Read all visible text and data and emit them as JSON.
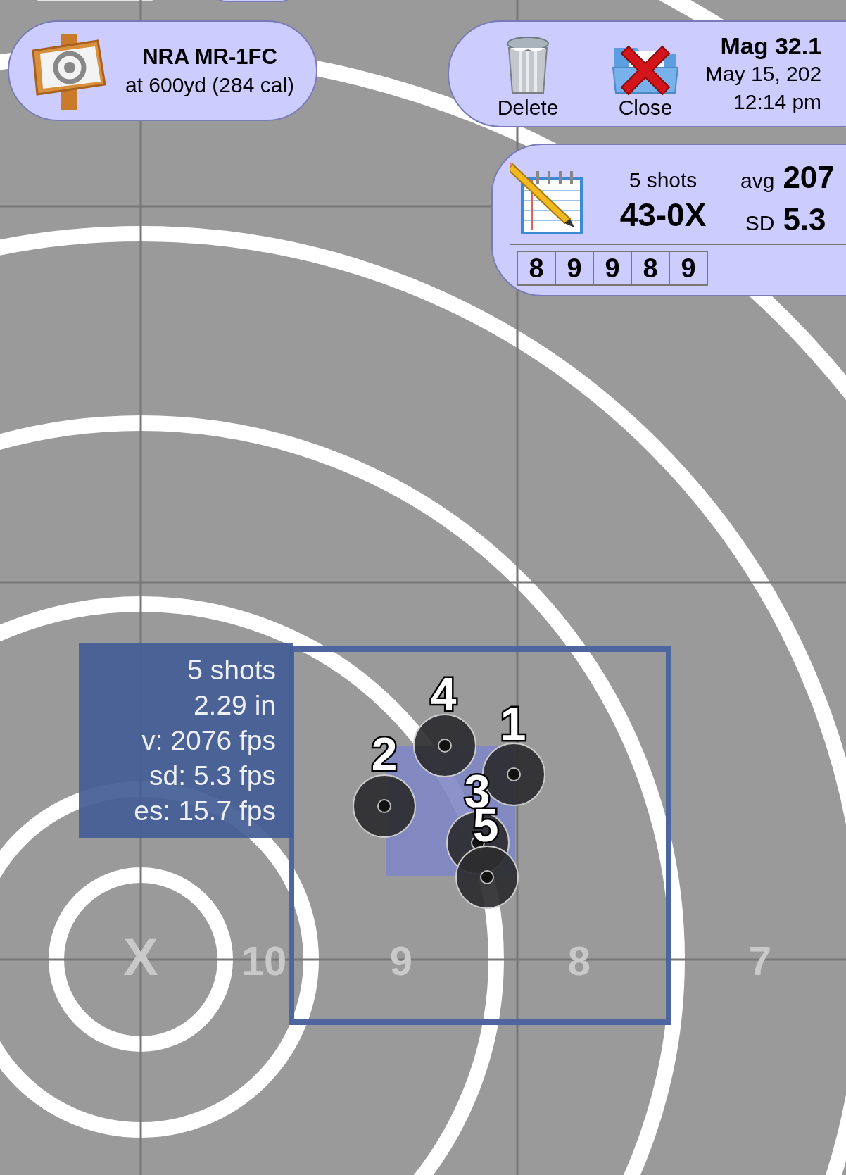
{
  "target": {
    "title": "NRA MR-1FC",
    "subtitle": "at 600yd (284 cal)"
  },
  "toolbar": {
    "buttons": [
      {
        "kind": "delete",
        "label": "Delete"
      },
      {
        "kind": "close",
        "label": "Close"
      }
    ],
    "session": {
      "title": "Mag 32.1",
      "date": "May 15, 202",
      "time": "12:14 pm"
    }
  },
  "summary": {
    "shots": "5 shots",
    "score": "43-0X",
    "avg_label": "avg",
    "avg_value": "207",
    "sd_label": "SD",
    "sd_value": "5.3",
    "scores": [
      "8",
      "9",
      "9",
      "8",
      "9"
    ]
  },
  "ring_labels": [
    "X",
    "10",
    "9",
    "8",
    "7"
  ],
  "group": {
    "lines": [
      "5 shots",
      "2.29 in",
      "v: 2076 fps",
      "sd: 5.3 fps",
      "es: 15.7 fps"
    ]
  },
  "shots": [
    {
      "label": "1"
    },
    {
      "label": "2"
    },
    {
      "label": "3"
    },
    {
      "label": "4"
    },
    {
      "label": "5"
    }
  ]
}
